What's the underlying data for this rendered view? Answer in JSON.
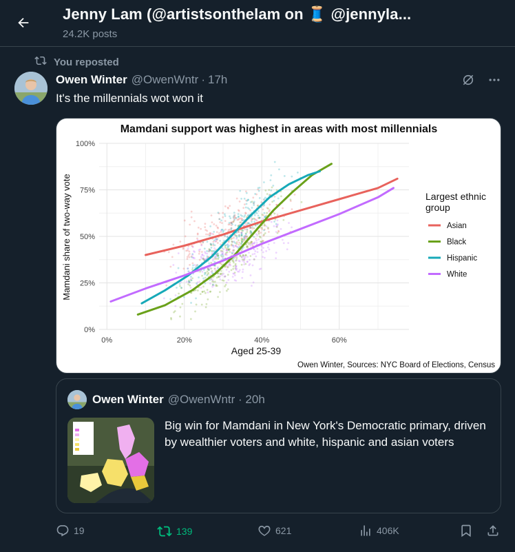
{
  "header": {
    "title": "Jenny Lam (@artistsonthelam on 🧵 @jennyla...",
    "posts": "24.2K posts"
  },
  "repost": {
    "label": "You reposted"
  },
  "tweet": {
    "author": "Owen Winter",
    "handle": "@OwenWntr",
    "sep": "·",
    "time": "17h",
    "text": "It's the millennials wot won it"
  },
  "chart_data": {
    "type": "line",
    "title": "Mamdani support was highest in areas with most millennials",
    "xlabel": "Aged 25-39",
    "ylabel": "Mamdani share of two-way vote",
    "x_ticks": [
      "0%",
      "20%",
      "40%",
      "60%"
    ],
    "y_ticks": [
      "0%",
      "25%",
      "50%",
      "75%",
      "100%"
    ],
    "xlim": [
      -0.02,
      0.78
    ],
    "ylim": [
      0,
      1
    ],
    "grid": true,
    "legend_title": "Largest ethnic group",
    "legend_position": "right",
    "caption": "Owen Winter, Sources: NYC Board of Elections, Census",
    "series": [
      {
        "name": "Asian",
        "color": "#e8625c",
        "x": [
          0.1,
          0.2,
          0.3,
          0.4,
          0.5,
          0.6,
          0.7,
          0.75
        ],
        "y": [
          0.4,
          0.45,
          0.51,
          0.58,
          0.64,
          0.7,
          0.76,
          0.81
        ]
      },
      {
        "name": "Black",
        "color": "#6aa11a",
        "x": [
          0.08,
          0.15,
          0.22,
          0.28,
          0.33,
          0.38,
          0.43,
          0.48,
          0.53,
          0.58
        ],
        "y": [
          0.08,
          0.13,
          0.21,
          0.3,
          0.4,
          0.52,
          0.64,
          0.74,
          0.83,
          0.89
        ]
      },
      {
        "name": "Hispanic",
        "color": "#17a9b8",
        "x": [
          0.09,
          0.15,
          0.21,
          0.27,
          0.32,
          0.37,
          0.42,
          0.47,
          0.52,
          0.55
        ],
        "y": [
          0.14,
          0.21,
          0.29,
          0.39,
          0.5,
          0.61,
          0.71,
          0.78,
          0.83,
          0.85
        ]
      },
      {
        "name": "White",
        "color": "#c26bff",
        "x": [
          0.01,
          0.1,
          0.2,
          0.3,
          0.4,
          0.5,
          0.6,
          0.7,
          0.74
        ],
        "y": [
          0.15,
          0.22,
          0.29,
          0.37,
          0.46,
          0.54,
          0.62,
          0.71,
          0.76
        ]
      }
    ]
  },
  "quote": {
    "author": "Owen Winter",
    "handle": "@OwenWntr · 20h",
    "text": "Big win for Mamdani in New York's Democratic primary, driven by wealthier voters and white, hispanic and asian voters"
  },
  "actions": {
    "replies": "19",
    "reposts": "139",
    "likes": "621",
    "views": "406K"
  },
  "colors": {
    "background": "#15202b",
    "muted": "#8b98a5",
    "repost_green": "#00ba7c"
  }
}
